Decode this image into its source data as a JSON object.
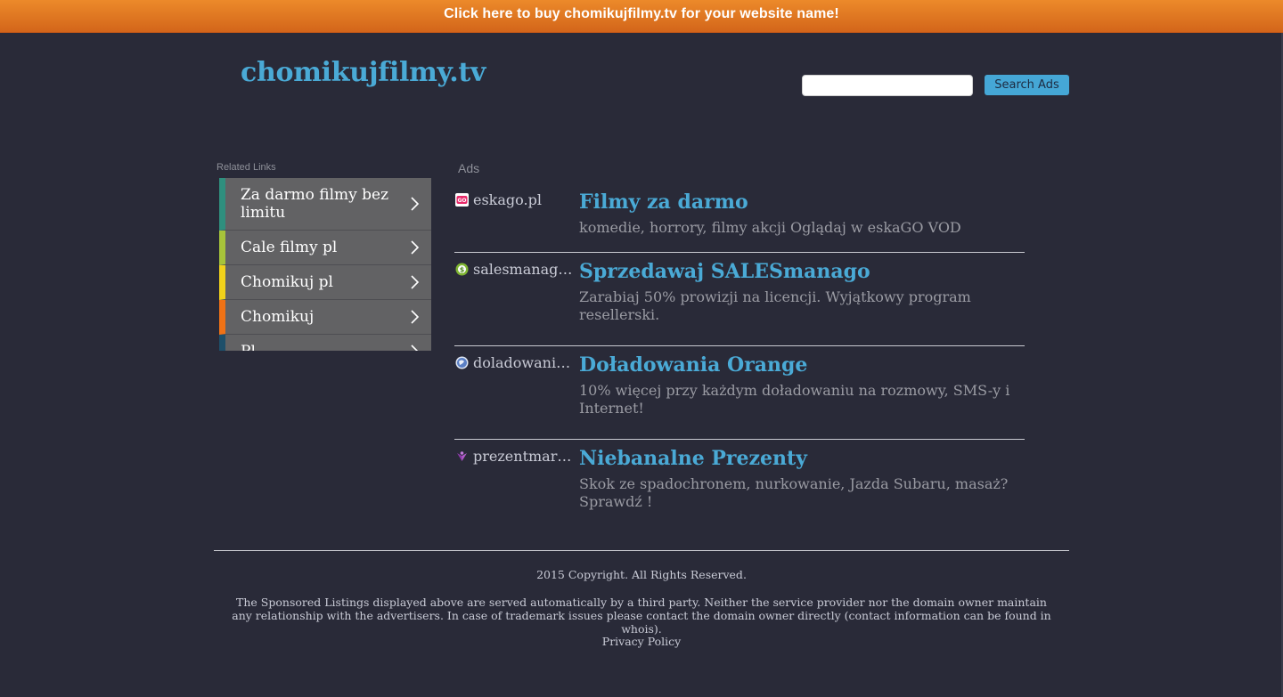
{
  "banner": {
    "text": "Click here to buy chomikujfilmy.tv for your website name!"
  },
  "header": {
    "site_title": "chomikujfilmy.tv",
    "search": {
      "value": "",
      "placeholder": "",
      "button_label": "Search Ads"
    }
  },
  "related": {
    "label": "Related Links",
    "items": [
      {
        "label": "Za darmo filmy bez limitu",
        "accent": "#2f8f7e"
      },
      {
        "label": "Cale filmy pl",
        "accent": "#a7c43a"
      },
      {
        "label": "Chomikuj pl",
        "accent": "#f1d21b"
      },
      {
        "label": "Chomikuj",
        "accent": "#ef7216"
      },
      {
        "label": "Pl",
        "accent": "#1d4f6a"
      }
    ]
  },
  "ads": {
    "label": "Ads",
    "items": [
      {
        "domain": "eskago.pl",
        "favicon": "eskago-icon",
        "title": "Filmy za darmo",
        "description": "komedie, horrory, filmy akcji Oglądaj w eskaGO VOD"
      },
      {
        "domain": "salesmanago.pl",
        "favicon": "salesmanago-icon",
        "title": "Sprzedawaj SALESmanago",
        "description": "Zarabiaj 50% prowizji na licencji. Wyjątkowy program resellerski."
      },
      {
        "domain": "doladowania.orange.pl",
        "favicon": "orange-globe-icon",
        "title": "Doładowania Orange",
        "description": "10% więcej przy każdym doładowaniu na rozmowy, SMS-y i Internet!"
      },
      {
        "domain": "prezentmarzen.com",
        "favicon": "prezentmarzen-icon",
        "title": "Niebanalne Prezenty",
        "description": "Skok ze spadochronem, nurkowanie, Jazda Subaru, masaż? Sprawdź !"
      }
    ]
  },
  "footer": {
    "copyright": "2015 Copyright. All Rights Reserved.",
    "disclaimer": "The Sponsored Listings displayed above are served automatically by a third party. Neither the service provider nor the domain owner maintain any relationship with the advertisers. In case of trademark issues please contact the domain owner directly (contact information can be found in whois).",
    "privacy_label": "Privacy Policy"
  },
  "colors": {
    "background": "#292a38",
    "banner": "#e07a22",
    "accent_blue": "#4aaad6"
  }
}
